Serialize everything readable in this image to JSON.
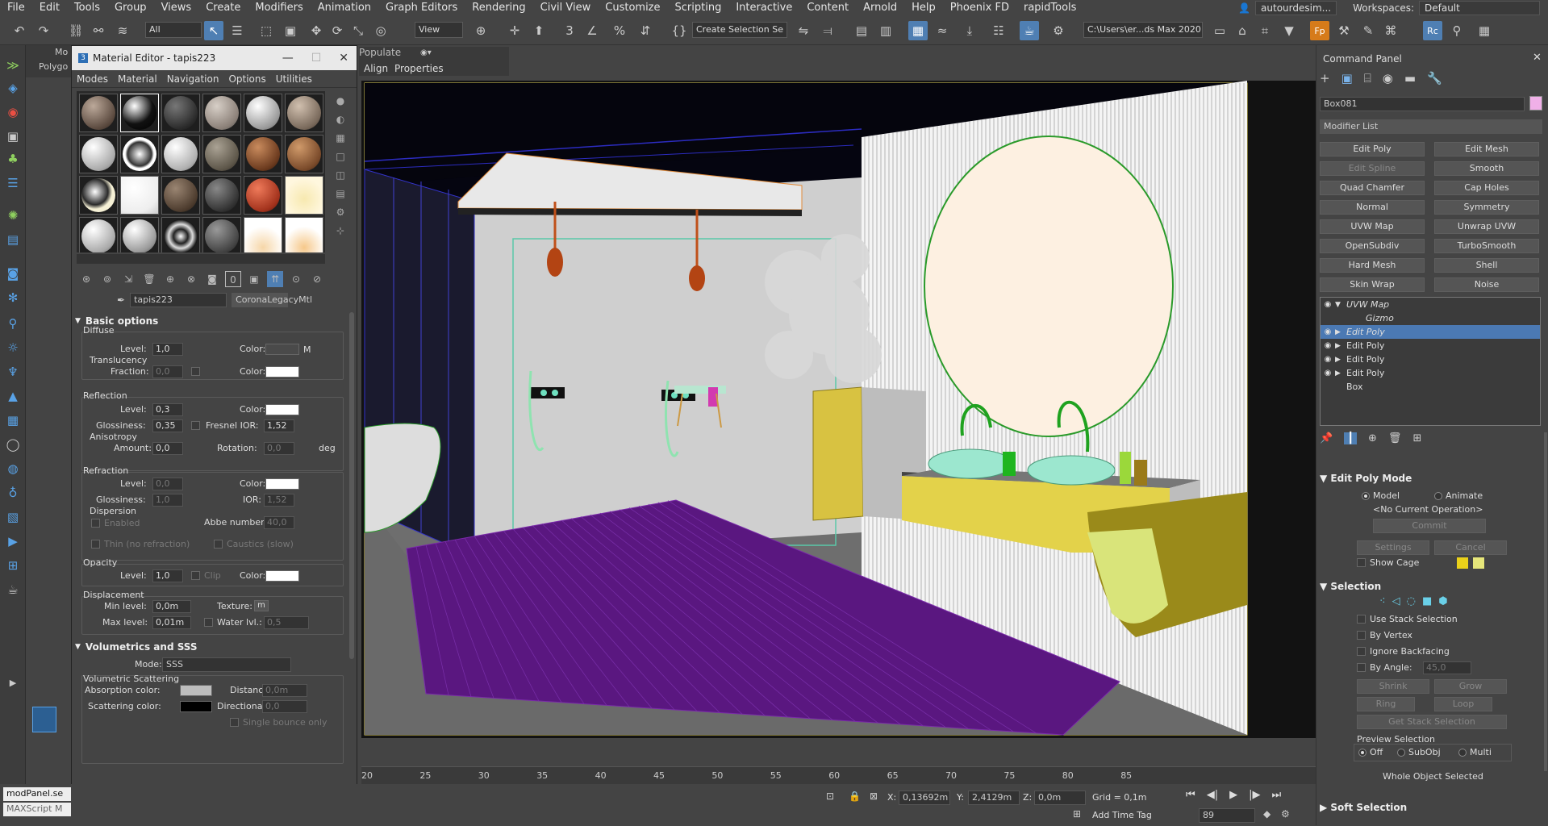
{
  "menu": [
    "File",
    "Edit",
    "Tools",
    "Group",
    "Views",
    "Create",
    "Modifiers",
    "Animation",
    "Graph Editors",
    "Rendering",
    "Civil View",
    "Customize",
    "Scripting",
    "Interactive",
    "Content",
    "Arnold",
    "Help",
    "Phoenix FD",
    "rapidTools"
  ],
  "user": "autourdesim...",
  "workspaces_label": "Workspaces:",
  "workspace": "Default",
  "toolbar": {
    "filter": "All",
    "view": "View",
    "selection_set": "Create Selection Se",
    "path": "C:\\Users\\er...ds Max 2020"
  },
  "ribbon": {
    "tab1": "Mo",
    "tab2": "Polygo",
    "populate": "Populate",
    "align": "Align",
    "properties": "Properties"
  },
  "material_editor": {
    "title": "Material Editor - tapis223",
    "menu": [
      "Modes",
      "Material",
      "Navigation",
      "Options",
      "Utilities"
    ],
    "material_name": "tapis223",
    "material_type": "CoronaLegacyMtl",
    "basic_options": "Basic options",
    "diffuse": {
      "group": "Diffuse",
      "level_label": "Level:",
      "level": "1,0",
      "color_label": "Color:",
      "map_btn": "M",
      "translucency": "Translucency",
      "fraction_label": "Fraction:",
      "fraction": "0,0",
      "t_color_label": "Color:"
    },
    "reflection": {
      "group": "Reflection",
      "level_label": "Level:",
      "level": "0,3",
      "color_label": "Color:",
      "gloss_label": "Glossiness:",
      "gloss": "0,35",
      "fresnel_label": "Fresnel IOR:",
      "fresnel": "1,52",
      "aniso": "Anisotropy",
      "amount_label": "Amount:",
      "amount": "0,0",
      "rotation_label": "Rotation:",
      "rotation": "0,0",
      "deg": "deg"
    },
    "refraction": {
      "group": "Refraction",
      "level_label": "Level:",
      "level": "0,0",
      "color_label": "Color:",
      "gloss_label": "Glossiness:",
      "gloss": "1,0",
      "ior_label": "IOR:",
      "ior": "1,52",
      "dispersion": "Dispersion",
      "enabled": "Enabled",
      "abbe_label": "Abbe number:",
      "abbe": "40,0",
      "thin": "Thin (no refraction)",
      "caustics": "Caustics (slow)"
    },
    "opacity": {
      "group": "Opacity",
      "level_label": "Level:",
      "level": "1,0",
      "clip": "Clip",
      "color_label": "Color:"
    },
    "displacement": {
      "group": "Displacement",
      "min_label": "Min level:",
      "min": "0,0m",
      "texture_label": "Texture:",
      "texture_btn": "m",
      "max_label": "Max level:",
      "max": "0,01m",
      "water_label": "Water lvl.:",
      "water": "0,5"
    },
    "volumetrics": "Volumetrics and SSS",
    "mode_label": "Mode:",
    "mode": "SSS",
    "vol_scattering": "Volumetric Scattering",
    "abs_label": "Absorption color:",
    "dist_label": "Distance:",
    "dist": "0,0m",
    "scat_label": "Scattering color:",
    "dir_label": "Directionality:",
    "dir": "0,0",
    "single": "Single bounce only"
  },
  "timeline": {
    "ticks": [
      "20",
      "25",
      "30",
      "35",
      "40",
      "45",
      "50",
      "55",
      "60",
      "65",
      "70",
      "75",
      "80",
      "85"
    ]
  },
  "status": {
    "script1": "modPanel.se",
    "script2": "MAXScript M",
    "x_label": "X:",
    "x": "0,13692m",
    "y_label": "Y:",
    "y": "2,4129m",
    "z_label": "Z:",
    "z": "0,0m",
    "grid": "Grid = 0,1m",
    "frame": "89",
    "add_time_tag": "Add Time Tag"
  },
  "command_panel": {
    "title": "Command Panel",
    "object_name": "Box081",
    "modifier_list": "Modifier List",
    "buttons": [
      "Edit Poly",
      "Edit Mesh",
      "Edit Spline",
      "Smooth",
      "Quad Chamfer",
      "Cap Holes",
      "Normal",
      "Symmetry",
      "UVW Map",
      "Unwrap UVW",
      "OpenSubdiv",
      "TurboSmooth",
      "Hard Mesh",
      "Shell",
      "Skin Wrap",
      "Noise"
    ],
    "stack": [
      "UVW Map",
      "Gizmo",
      "Edit Poly",
      "Edit Poly",
      "Edit Poly",
      "Edit Poly",
      "Box"
    ],
    "edit_poly_mode": "Edit Poly Mode",
    "model": "Model",
    "animate": "Animate",
    "no_op": "<No Current Operation>",
    "commit": "Commit",
    "settings": "Settings",
    "cancel": "Cancel",
    "show_cage": "Show Cage",
    "selection": "Selection",
    "use_stack": "Use Stack Selection",
    "by_vertex": "By Vertex",
    "ignore_bf": "Ignore Backfacing",
    "by_angle": "By Angle:",
    "angle": "45,0",
    "shrink": "Shrink",
    "grow": "Grow",
    "ring": "Ring",
    "loop": "Loop",
    "get_stack": "Get Stack Selection",
    "preview": "Preview Selection",
    "off": "Off",
    "subobj": "SubObj",
    "multi": "Multi",
    "whole": "Whole Object Selected",
    "soft": "Soft Selection"
  },
  "colors": {
    "accent": "#4f7fb3",
    "viewport_border": "#e5d75a",
    "rug": "#5a1780",
    "cabinet": "#e3d24a",
    "mirror": "#fdf0e1"
  }
}
